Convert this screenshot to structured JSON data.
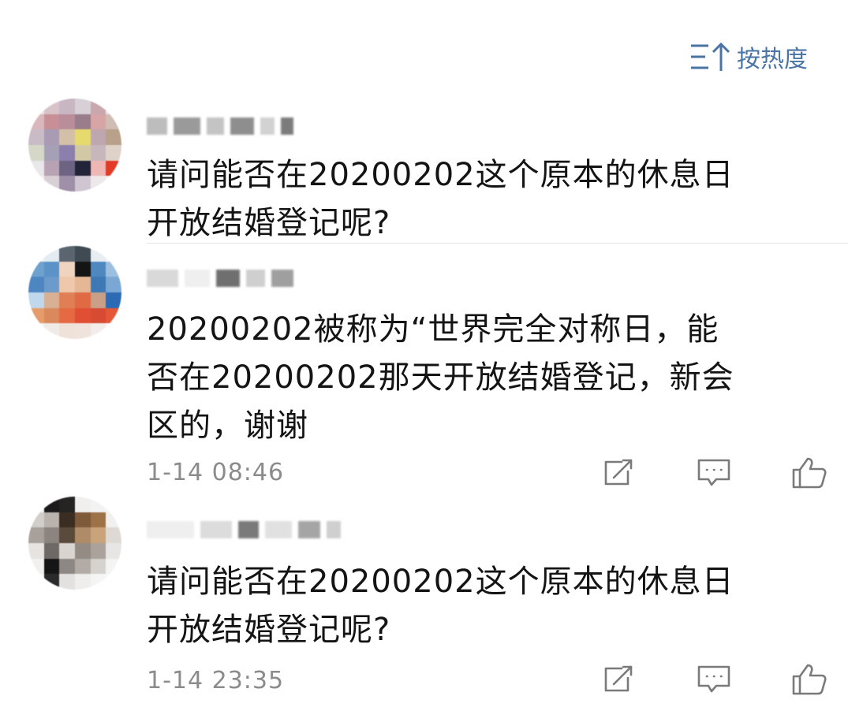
{
  "sort": {
    "label": "按热度",
    "icon": "sort-desc-icon"
  },
  "comments": [
    {
      "content_line1": "请问能否在20200202这个原本的休息日",
      "content_line2": "开放结婚登记呢?",
      "time": ""
    },
    {
      "content_line1": "20200202被称为“世界完全对称日，能",
      "content_line2": "否在20200202那天开放结婚登记，新会",
      "content_line3": "区的，谢谢",
      "time": "1-14 08:46"
    },
    {
      "content_line1": "请问能否在20200202这个原本的休息日",
      "content_line2": "开放结婚登记呢?",
      "time": "1-14 23:35"
    }
  ],
  "icons": {
    "share": "share-icon",
    "reply": "comment-icon",
    "like": "thumbs-up-icon"
  },
  "colors": {
    "accent": "#4a74a6",
    "meta": "#8b8b8b",
    "text": "#141414"
  }
}
